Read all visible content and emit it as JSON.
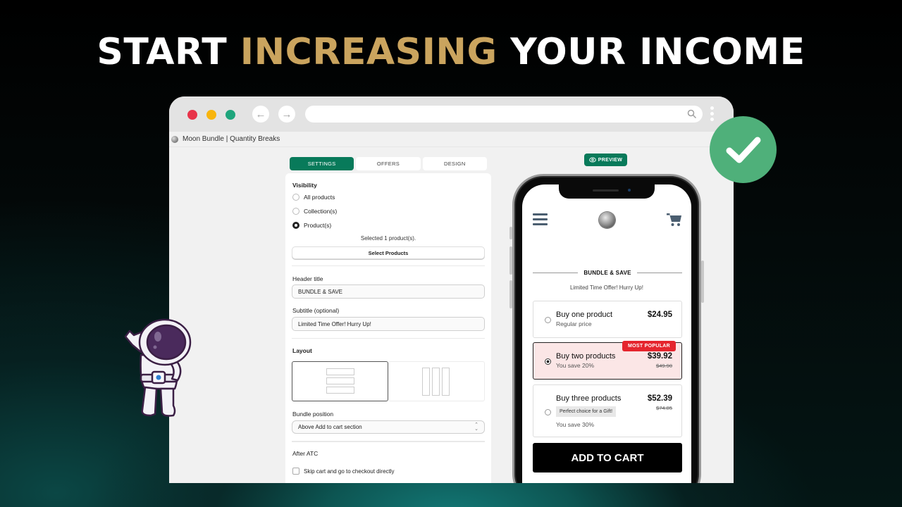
{
  "headline": {
    "part1": "START ",
    "highlight": "INCREASING",
    "part2": " YOUR INCOME",
    "highlight_color": "#caa45e"
  },
  "browser": {
    "tab_title": "Moon Bundle | Quantity Breaks",
    "url": "",
    "icons": {
      "back": "arrow-left-icon",
      "forward": "arrow-right-icon",
      "search": "search-icon",
      "menu": "kebab-menu-icon"
    }
  },
  "settings": {
    "tabs": [
      {
        "label": "SETTINGS",
        "active": true
      },
      {
        "label": "OFFERS",
        "active": false
      },
      {
        "label": "DESIGN",
        "active": false
      }
    ],
    "visibility": {
      "label": "Visibility",
      "options": [
        {
          "label": "All products",
          "selected": false
        },
        {
          "label": "Collection(s)",
          "selected": false
        },
        {
          "label": "Product(s)",
          "selected": true
        }
      ],
      "selected_note": "Selected 1 product(s).",
      "select_button": "Select Products"
    },
    "header_title": {
      "label": "Header title",
      "value": "BUNDLE & SAVE"
    },
    "subtitle": {
      "label": "Subtitle (optional)",
      "value": "Limited Time Offer! Hurry Up!"
    },
    "layout": {
      "label": "Layout",
      "options": [
        "vertical-stack",
        "horizontal-columns"
      ],
      "selected": "vertical-stack"
    },
    "bundle_position": {
      "label": "Bundle position",
      "value": "Above Add to cart section"
    },
    "after_atc": {
      "label": "After ATC",
      "checkbox_label": "Skip cart and go to checkout directly",
      "checked": false
    }
  },
  "preview": {
    "button_label": "PREVIEW",
    "title": "BUNDLE & SAVE",
    "subtitle": "Limited Time Offer! Hurry Up!",
    "offers": [
      {
        "title": "Buy one product",
        "subtitle": "Regular price",
        "price": "$24.95",
        "old_price": "",
        "selected": false,
        "badge": "",
        "tag": ""
      },
      {
        "title": "Buy two products",
        "subtitle": "You save 20%",
        "price": "$39.92",
        "old_price": "$49.90",
        "selected": true,
        "badge": "MOST POPULAR",
        "tag": ""
      },
      {
        "title": "Buy three products",
        "subtitle": "You save 30%",
        "price": "$52.39",
        "old_price": "$74.85",
        "selected": false,
        "badge": "",
        "tag": "Perfect choice for a Gift!"
      }
    ],
    "add_to_cart": "ADD TO CART",
    "badge_color": "#e5252e",
    "accent_color": "#087a5a"
  }
}
